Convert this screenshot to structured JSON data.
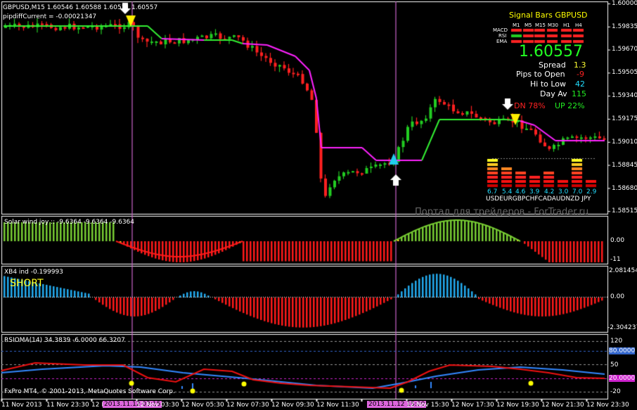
{
  "colors": {
    "background": "#000000",
    "grid_text": "#ffffff",
    "bull": "#22cc22",
    "bear": "#ff2020",
    "trend_up": "#33ee33",
    "trend_down": "#ff22ff",
    "histogram_up": "#77cc33",
    "histogram_down": "#ff1a1a",
    "xb4_up": "#22aaee",
    "rsi_line": "#ee1111",
    "ma_line": "#3388ff",
    "vline": "#cc66cc",
    "signal_title": "#ffff00",
    "big_price": "#22ff22",
    "value_yellow": "#ffff33",
    "value_red": "#ff2222",
    "value_cyan": "#22ddff"
  },
  "main": {
    "header": "GBPUSD,M15  1.60546 1.60588 1.60531 1.60557",
    "sub_header": "pipdiffCurrent = -0.00021347",
    "price_axis": [
      "1.60000",
      "1.59835",
      "1.59670",
      "1.59505",
      "1.59340",
      "1.59175",
      "1.59010",
      "1.58845",
      "1.58680",
      "1.58515"
    ],
    "watermark": "Портал для трейдеров - ForTrader.ru"
  },
  "signal_panel": {
    "title": "Signal Bars GBPUSD",
    "timeframes": [
      "M1",
      "M5",
      "M15",
      "M30",
      "H1",
      "H4"
    ],
    "rows": [
      "MACD",
      "RSI",
      "EMA"
    ],
    "price": "1.60557",
    "spread_label": "Spread",
    "spread_value": "1.3",
    "pips_label": "Pips to Open",
    "pips_value": "-9",
    "hilo_label": "Hi to Low",
    "hilo_value": "42",
    "dayav_label": "Day Av",
    "dayav_value": "115",
    "dn_label": "DN 78%",
    "up_label": "UP 22%"
  },
  "currency_meter": {
    "values": [
      "6.7",
      "5.4",
      "4.6",
      "3.9",
      "4.2",
      "3.0",
      "7.0",
      "2.9"
    ],
    "currencies": "USDEURGBPCHFCADAUDNZD JPY"
  },
  "solar_panel": {
    "label": "Solar wind joy :: -9.6364 -9.6364 -9.6364",
    "axis": [
      "0.00",
      "-11"
    ]
  },
  "xb4_panel": {
    "label": "XB4 ind -0.199993",
    "signal": "SHORT",
    "axis": [
      "2.081454",
      "0.00",
      "-2.304237"
    ]
  },
  "rsioma_panel": {
    "label": "RSIOMA(14) 34.3839 -6.0000 66.3207",
    "axis": [
      "120",
      "80.0000",
      "50",
      "20.0000",
      "-20"
    ],
    "copyright": "FxPro MT4, © 2001-2013, MetaQuotes Software Corp."
  },
  "time_axis": [
    "11 Nov 2013",
    "11 Nov 23:30",
    "12 Nov 01:30",
    "2013.11.12 03:15",
    "12 Nov 03:30",
    "12 Nov 05:30",
    "12 Nov 07:30",
    "12 Nov 09:30",
    "12 Nov 11:30",
    "2013.11.12 15:00",
    "12 Nov 15:30",
    "12 Nov 17:30",
    "12 Nov 19:30",
    "12 Nov 21:30",
    "12 Nov 23:30"
  ]
}
